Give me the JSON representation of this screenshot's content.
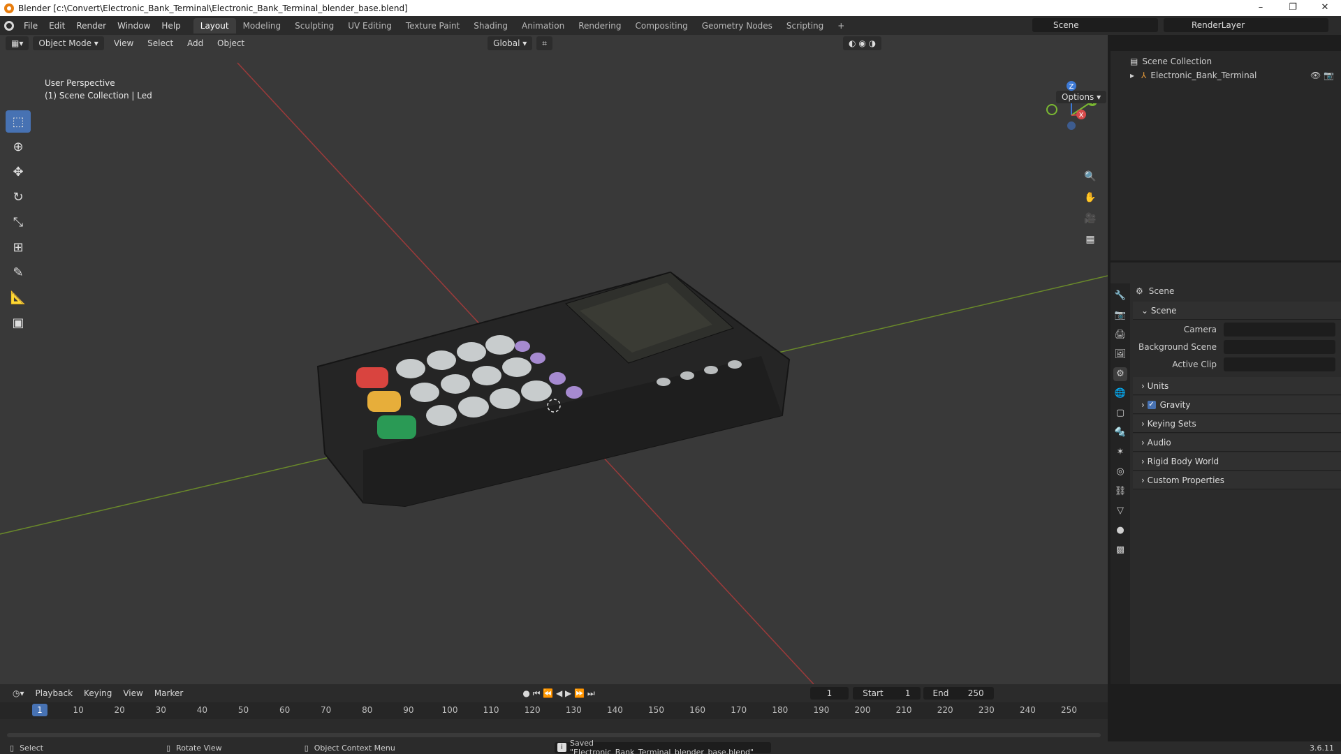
{
  "title": "Blender [c:\\Convert\\Electronic_Bank_Terminal\\Electronic_Bank_Terminal_blender_base.blend]",
  "menu": [
    "File",
    "Edit",
    "Render",
    "Window",
    "Help"
  ],
  "workspaces": [
    "Layout",
    "Modeling",
    "Sculpting",
    "UV Editing",
    "Texture Paint",
    "Shading",
    "Animation",
    "Rendering",
    "Compositing",
    "Geometry Nodes",
    "Scripting",
    "+"
  ],
  "active_workspace": "Layout",
  "scene": "Scene",
  "renderlayer": "RenderLayer",
  "viewport": {
    "mode": "Object Mode",
    "menus": [
      "View",
      "Select",
      "Add",
      "Object"
    ],
    "orientation": "Global",
    "options": "Options",
    "overlay_line1": "User Perspective",
    "overlay_line2": "(1) Scene Collection | Led",
    "gizmo": {
      "z": "Z",
      "y": "Y",
      "x": "X"
    }
  },
  "outliner": {
    "root": "Scene Collection",
    "item": "Electronic_Bank_Terminal"
  },
  "properties": {
    "header": "Scene",
    "section": "Scene",
    "rows": [
      {
        "label": "Camera"
      },
      {
        "label": "Background Scene"
      },
      {
        "label": "Active Clip"
      }
    ],
    "panels": [
      "Units",
      "Gravity",
      "Keying Sets",
      "Audio",
      "Rigid Body World",
      "Custom Properties"
    ],
    "gravity_checked": true
  },
  "timeline": {
    "menus": [
      "Playback",
      "Keying",
      "View",
      "Marker"
    ],
    "current_frame": "1",
    "start_label": "Start",
    "start": "1",
    "end_label": "End",
    "end": "250",
    "ticks": [
      "10",
      "20",
      "30",
      "40",
      "50",
      "60",
      "70",
      "80",
      "90",
      "100",
      "110",
      "120",
      "130",
      "140",
      "150",
      "160",
      "170",
      "180",
      "190",
      "200",
      "210",
      "220",
      "230",
      "240",
      "250"
    ],
    "playhead": "1"
  },
  "status": {
    "select": "Select",
    "rotate": "Rotate View",
    "context": "Object Context Menu",
    "message": "Saved \"Electronic_Bank_Terminal_blender_base.blend\"",
    "version": "3.6.11"
  }
}
